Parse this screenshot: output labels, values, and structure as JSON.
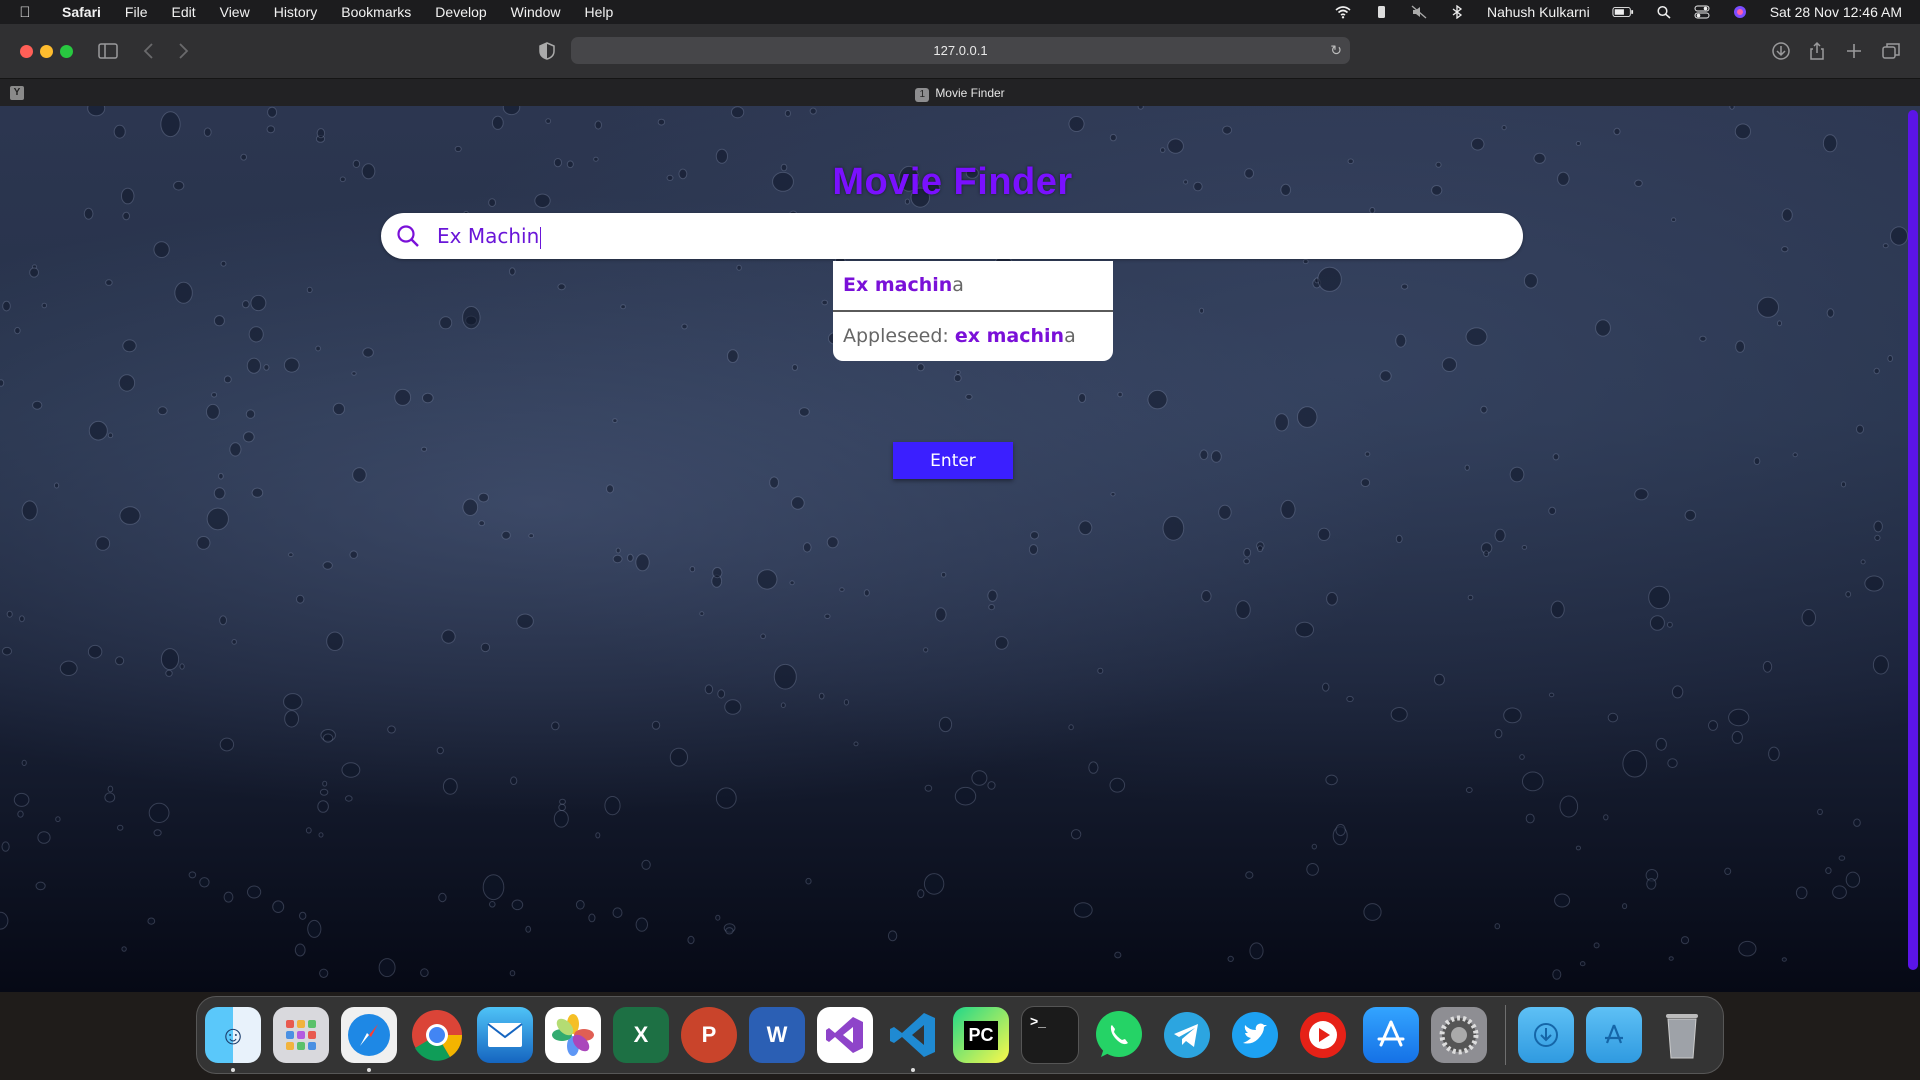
{
  "menubar": {
    "app_name": "Safari",
    "menus": [
      "File",
      "Edit",
      "View",
      "History",
      "Bookmarks",
      "Develop",
      "Window",
      "Help"
    ],
    "user_name": "Nahush Kulkarni",
    "date_time": "Sat 28 Nov  12:46 AM"
  },
  "browser": {
    "url": "127.0.0.1",
    "tab_title": "Movie Finder",
    "tab_number": "1",
    "pinned_tab_letter": "Y"
  },
  "page": {
    "title": "Movie Finder",
    "search_value": "Ex Machin",
    "suggestions": [
      {
        "prefix": "",
        "match": "Ex machin",
        "rest": "a"
      },
      {
        "prefix": "Appleseed: ",
        "match": "ex machin",
        "rest": "a"
      }
    ],
    "enter_label": "Enter"
  },
  "colors": {
    "title": "#7a10ff",
    "button": "#3b1fff",
    "highlight": "#7a10d8"
  },
  "dock": {
    "apps": [
      "finder-icon",
      "launchpad-icon",
      "safari-icon",
      "chrome-icon",
      "mail-icon",
      "photos-icon",
      "excel-icon",
      "powerpoint-icon",
      "word-icon",
      "visual-studio-icon",
      "vscode-icon",
      "pycharm-icon",
      "terminal-icon",
      "whatsapp-icon",
      "telegram-icon",
      "twitter-icon",
      "youtube-icon",
      "app-store-icon",
      "system-preferences-icon",
      "downloads-folder-icon",
      "applications-folder-icon",
      "trash-icon"
    ]
  }
}
